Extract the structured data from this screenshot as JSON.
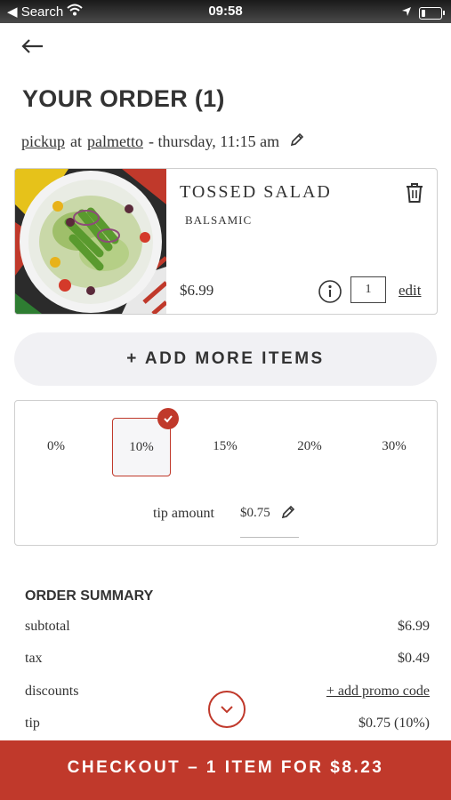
{
  "status_bar": {
    "back_label": "◀ Search",
    "time": "09:58"
  },
  "page": {
    "title": "YOUR ORDER (1)"
  },
  "pickup": {
    "mode": "pickup",
    "at": "at",
    "location": "palmetto",
    "when": "- thursday, 11:15 am"
  },
  "item": {
    "name": "TOSSED SALAD",
    "option": "BALSAMIC",
    "price": "$6.99",
    "quantity": "1",
    "edit_label": "edit"
  },
  "add_more_label": "+ ADD MORE ITEMS",
  "tip": {
    "options": [
      "0%",
      "10%",
      "15%",
      "20%",
      "30%"
    ],
    "selected_index": 1,
    "amount_label": "tip amount",
    "amount_value": "$0.75"
  },
  "summary": {
    "heading": "ORDER SUMMARY",
    "subtotal_label": "subtotal",
    "subtotal_value": "$6.99",
    "tax_label": "tax",
    "tax_value": "$0.49",
    "discounts_label": "discounts",
    "promo_label": "+ add promo code",
    "tip_label": "tip",
    "tip_value": "$0.75 (10%)"
  },
  "checkout_label": "CHECKOUT – 1 ITEM FOR $8.23",
  "colors": {
    "accent": "#c0392b",
    "button_bg": "#f1f1f4"
  }
}
